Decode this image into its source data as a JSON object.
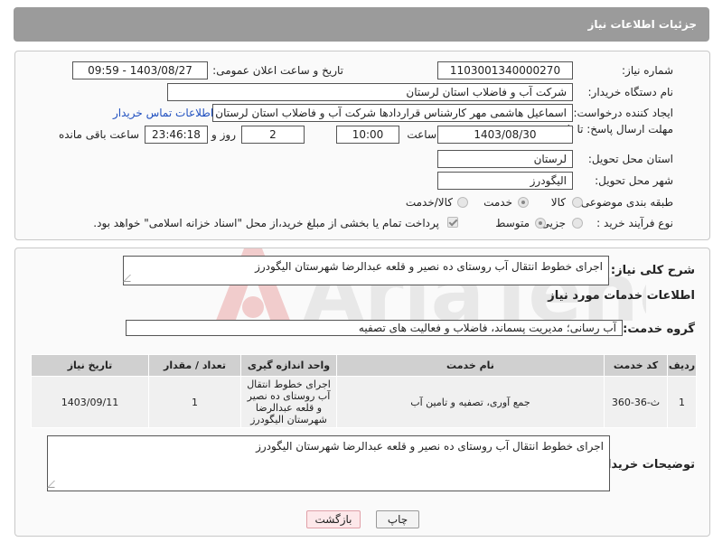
{
  "header": {
    "title": "جزئیات اطلاعات نیاز"
  },
  "form": {
    "need_number_label": "شماره نیاز:",
    "need_number": "1103001340000270",
    "announce_label": "تاریخ و ساعت اعلان عمومی:",
    "announce_value": "1403/08/27 - 09:59",
    "buyer_org_label": "نام دستگاه خریدار:",
    "buyer_org": "شرکت آب و فاضلاب استان لرستان",
    "creator_label": "ایجاد کننده درخواست:",
    "creator": "اسماعیل هاشمی مهر کارشناس قراردادها شرکت آب و فاضلاب استان لرستان",
    "contact_link": "اطلاعات تماس خریدار",
    "deadline_label": "مهلت ارسال پاسخ: تا تاریخ:",
    "deadline_date": "1403/08/30",
    "time_label": "ساعت",
    "deadline_time": "10:00",
    "days": "2",
    "days_label": "روز و",
    "remaining": "23:46:18",
    "remaining_label": "ساعت باقی مانده",
    "province_label": "استان محل تحویل:",
    "province": "لرستان",
    "city_label": "شهر محل تحویل:",
    "city": "الیگودرز",
    "category_label": "طبقه بندی موضوعی:",
    "cat_goods": "کالا",
    "cat_service": "خدمت",
    "cat_goods_service": "کالا/خدمت",
    "process_label": "نوع فرآیند خرید :",
    "proc_partial": "جزیی",
    "proc_medium": "متوسط",
    "payment_note": "پرداخت تمام یا بخشی از مبلغ خرید،از محل \"اسناد خزانه اسلامی\" خواهد بود."
  },
  "details": {
    "summary_label": "شرح کلی نیاز:",
    "summary": "اجرای خطوط انتقال آب روستای ده نصیر و قلعه عبدالرضا شهرستان الیگودرز",
    "services_title": "اطلاعات خدمات مورد نیاز",
    "group_label": "گروه خدمت:",
    "group": "آب رسانی؛ مدیریت پسماند، فاضلاب و فعالیت های تصفیه",
    "table": {
      "headers": [
        "ردیف",
        "کد خدمت",
        "نام خدمت",
        "واحد اندازه گیری",
        "تعداد / مقدار",
        "تاریخ نیاز"
      ],
      "rows": [
        [
          "1",
          "ث-36-360",
          "جمع آوری، تصفیه و تامین آب",
          "اجرای خطوط انتقال آب روستای ده نصیر و قلعه عبدالرضا شهرستان الیگودرز",
          "1",
          "1403/09/11"
        ]
      ]
    },
    "buyer_notes_label": "توضیحات خریدار:",
    "buyer_notes": "اجرای خطوط انتقال آب روستای ده نصیر و قلعه عبدالرضا شهرستان الیگودرز"
  },
  "buttons": {
    "print": "چاپ",
    "back": "بازگشت"
  },
  "watermark": {
    "text": "AriaTender.neT"
  }
}
